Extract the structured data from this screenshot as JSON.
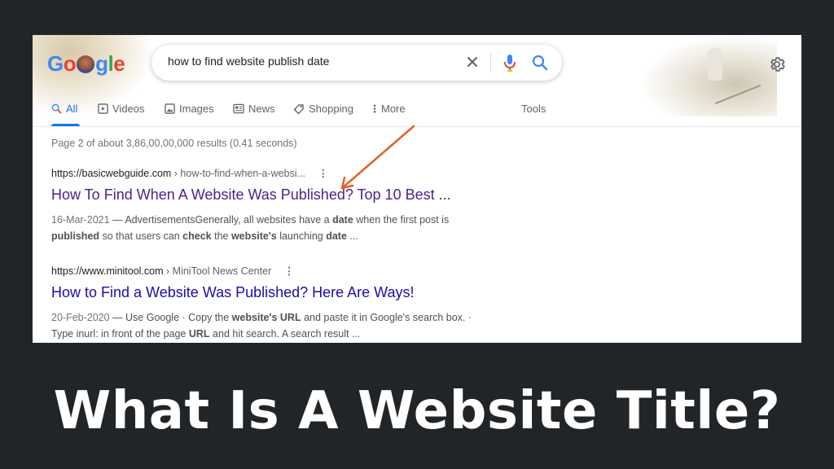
{
  "logo": {
    "text": "Google"
  },
  "search": {
    "query": "how to find website publish date"
  },
  "icons": {
    "clear": "close-icon",
    "mic": "microphone-icon",
    "search": "search-icon",
    "settings": "gear-icon"
  },
  "tabs": [
    {
      "label": "All",
      "icon": "search-icon",
      "active": true
    },
    {
      "label": "Videos",
      "icon": "play-icon",
      "active": false
    },
    {
      "label": "Images",
      "icon": "image-icon",
      "active": false
    },
    {
      "label": "News",
      "icon": "news-icon",
      "active": false
    },
    {
      "label": "Shopping",
      "icon": "tag-icon",
      "active": false
    },
    {
      "label": "More",
      "icon": "more-vert-icon",
      "active": false
    }
  ],
  "tools_label": "Tools",
  "stats": "Page 2 of about 3,86,00,00,000 results (0.41 seconds)",
  "results": [
    {
      "site": "https://basicwebguide.com",
      "path": " › how-to-find-when-a-websi...",
      "title": "How To Find When A Website Was Published? Top 10 Best ...",
      "date": "16-Mar-2021",
      "snippet_line1_parts": [
        " — AdvertisementsGenerally, all websites have a ",
        "date",
        " when the first post is"
      ],
      "snippet_line2_parts": [
        "published",
        " so that users can ",
        "check",
        " the ",
        "website's",
        " launching ",
        "date",
        " ..."
      ]
    },
    {
      "site": "https://www.minitool.com",
      "path": " › MiniTool News Center",
      "title": "How to Find a Website Was Published? Here Are Ways!",
      "date": "20-Feb-2020",
      "snippet_line1_parts": [
        " — Use Google · Copy the ",
        "website's URL",
        " and paste it in Google's search box. ·"
      ],
      "snippet_line2_parts": [
        "Type inurl: in front of the page ",
        "URL",
        " and hit search. A search result ..."
      ]
    }
  ],
  "headline": "What Is A Website Title?",
  "colors": {
    "background": "#222528",
    "accent_blue": "#1a73e8",
    "visited_link": "#4b238c",
    "link": "#1a0dab",
    "arrow": "#e2622b"
  }
}
